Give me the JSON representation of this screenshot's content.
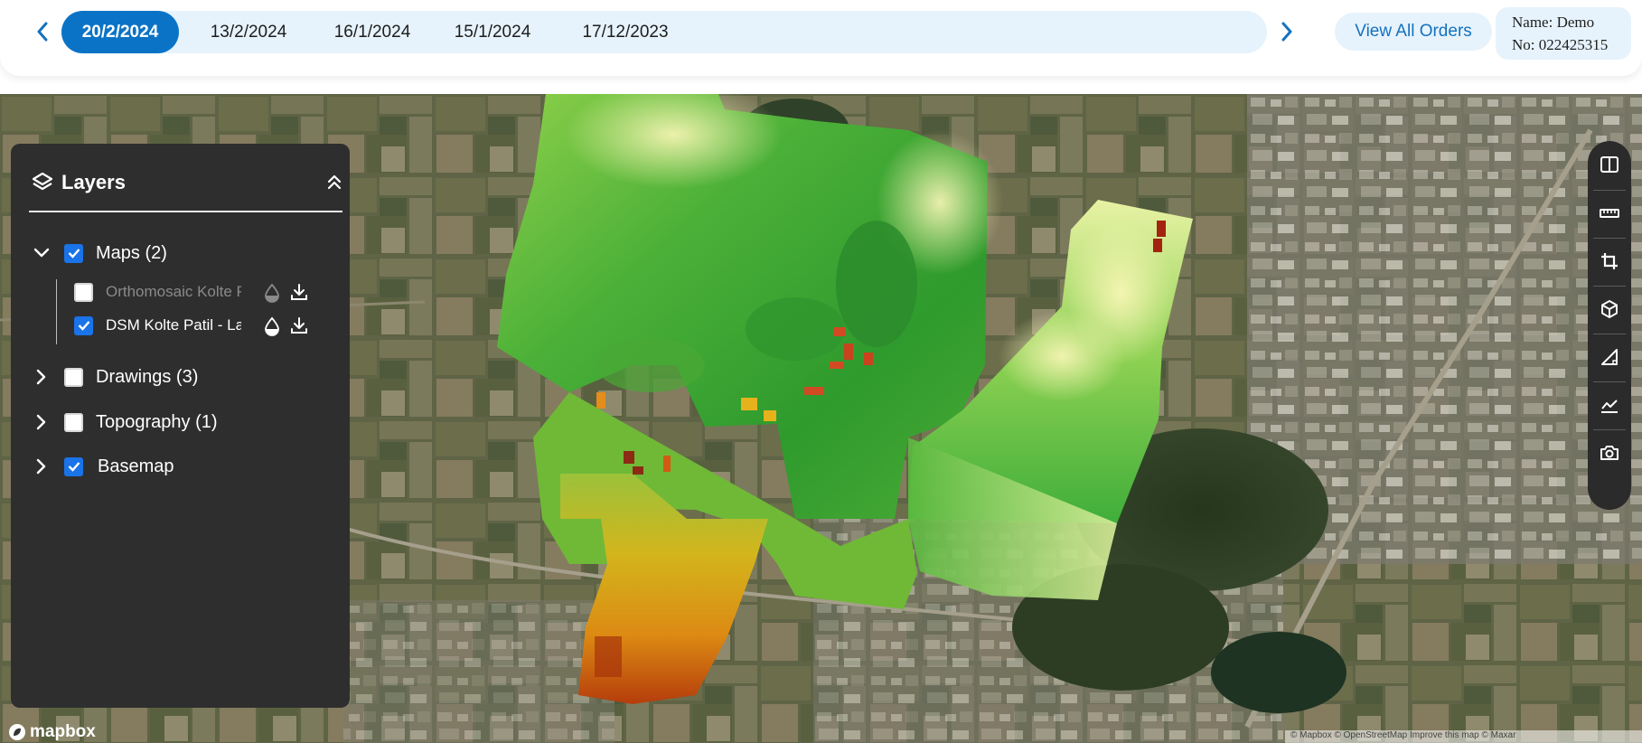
{
  "dates": {
    "items": [
      "20/2/2024",
      "13/2/2024",
      "16/1/2024",
      "15/1/2024",
      "17/12/2023"
    ],
    "active_index": 0
  },
  "header": {
    "view_all_label": "View All Orders",
    "user_name_line": "Name: Demo",
    "user_no_line": "No: 022425315"
  },
  "layers": {
    "title": "Layers",
    "groups": [
      {
        "label": "Maps (2)",
        "checked": true,
        "expanded": true
      },
      {
        "label": "Drawings (3)",
        "checked": false,
        "expanded": false
      },
      {
        "label": "Topography (1)",
        "checked": false,
        "expanded": false
      },
      {
        "label": "Basemap",
        "checked": true,
        "expanded": false
      }
    ],
    "map_items": [
      {
        "label": "Orthomosaic Kolte Patil",
        "checked": false,
        "dimmed": true
      },
      {
        "label": "DSM Kolte Patil - Lavasa",
        "checked": true,
        "dimmed": false
      }
    ]
  },
  "toolbar": {
    "tools": [
      "split-view-icon",
      "ruler-icon",
      "crop-icon",
      "cube-3d-icon",
      "area-triangle-icon",
      "elevation-profile-icon",
      "camera-icon"
    ]
  },
  "footer": {
    "logo_text": "mapbox",
    "attribution": "© Mapbox © OpenStreetMap Improve this map © Maxar"
  },
  "colors": {
    "accent": "#0b73c6",
    "panel_bg": "#2e2e2e",
    "checkbox_on": "#1a73e8"
  }
}
